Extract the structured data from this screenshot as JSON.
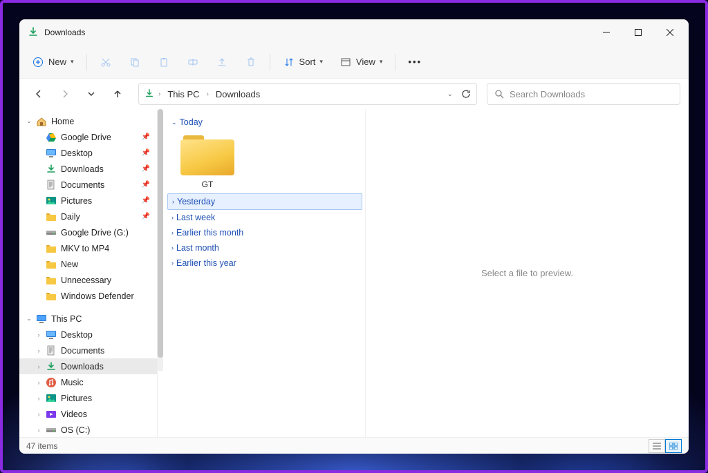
{
  "window": {
    "title": "Downloads"
  },
  "toolbar": {
    "new_label": "New",
    "sort_label": "Sort",
    "view_label": "View"
  },
  "breadcrumb": {
    "items": [
      "This PC",
      "Downloads"
    ]
  },
  "search": {
    "placeholder": "Search Downloads"
  },
  "sidebar": {
    "home_label": "Home",
    "quick": [
      {
        "label": "Google Drive",
        "icon": "gdrive",
        "pinned": true
      },
      {
        "label": "Desktop",
        "icon": "desktop",
        "pinned": true
      },
      {
        "label": "Downloads",
        "icon": "downloads",
        "pinned": true
      },
      {
        "label": "Documents",
        "icon": "documents",
        "pinned": true
      },
      {
        "label": "Pictures",
        "icon": "pictures",
        "pinned": true
      },
      {
        "label": "Daily",
        "icon": "folder",
        "pinned": true
      },
      {
        "label": "Google Drive (G:)",
        "icon": "drive",
        "pinned": false
      },
      {
        "label": "MKV to MP4",
        "icon": "folder",
        "pinned": false
      },
      {
        "label": "New",
        "icon": "folder",
        "pinned": false
      },
      {
        "label": "Unnecessary",
        "icon": "folder",
        "pinned": false
      },
      {
        "label": "Windows Defender",
        "icon": "folder",
        "pinned": false
      }
    ],
    "thispc_label": "This PC",
    "thispc": [
      {
        "label": "Desktop",
        "icon": "desktop"
      },
      {
        "label": "Documents",
        "icon": "documents"
      },
      {
        "label": "Downloads",
        "icon": "downloads",
        "selected": true
      },
      {
        "label": "Music",
        "icon": "music"
      },
      {
        "label": "Pictures",
        "icon": "pictures"
      },
      {
        "label": "Videos",
        "icon": "videos"
      },
      {
        "label": "OS (C:)",
        "icon": "drive"
      }
    ]
  },
  "content": {
    "groups": [
      {
        "label": "Today",
        "expanded": true,
        "items": [
          {
            "name": "GT",
            "type": "folder"
          }
        ]
      },
      {
        "label": "Yesterday",
        "expanded": false,
        "selected": true
      },
      {
        "label": "Last week",
        "expanded": false
      },
      {
        "label": "Earlier this month",
        "expanded": false
      },
      {
        "label": "Last month",
        "expanded": false
      },
      {
        "label": "Earlier this year",
        "expanded": false
      }
    ]
  },
  "preview": {
    "empty_text": "Select a file to preview."
  },
  "status": {
    "item_count_label": "47 items"
  }
}
